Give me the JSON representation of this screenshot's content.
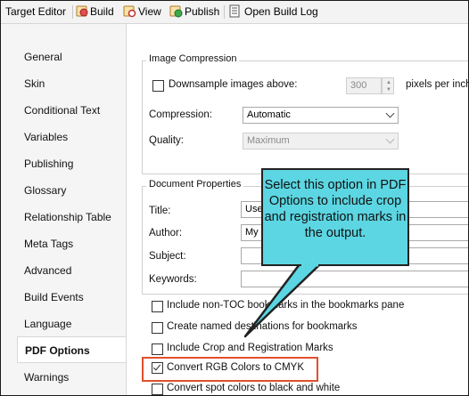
{
  "toolbar": {
    "title": "Target Editor",
    "build": "Build",
    "view": "View",
    "publish": "Publish",
    "open_build_log": "Open Build Log"
  },
  "nav": {
    "items": [
      "General",
      "Skin",
      "Conditional Text",
      "Variables",
      "Publishing",
      "Glossary",
      "Relationship Table",
      "Meta Tags",
      "Advanced",
      "Build Events",
      "Language",
      "PDF Options",
      "Warnings"
    ],
    "active": "PDF Options"
  },
  "image_compression": {
    "title": "Image Compression",
    "downsample_label": "Downsample images above:",
    "downsample_value": "300",
    "downsample_unit": "pixels per inch",
    "downsample_checked": false,
    "compression_label": "Compression:",
    "compression_value": "Automatic",
    "quality_label": "Quality:",
    "quality_value": "Maximum"
  },
  "document_properties": {
    "title": "Document Properties",
    "title_label": "Title:",
    "title_value": "User",
    "author_label": "Author:",
    "author_value": "My N",
    "subject_label": "Subject:",
    "subject_value": "",
    "keywords_label": "Keywords:",
    "keywords_value": ""
  },
  "options": [
    {
      "label": "Include non-TOC bookmarks in the bookmarks pane",
      "checked": false
    },
    {
      "label": "Create named destinations for bookmarks",
      "checked": false
    },
    {
      "label": "Include Crop and Registration Marks",
      "checked": false
    },
    {
      "label": "Convert RGB Colors to CMYK",
      "checked": true
    },
    {
      "label": "Convert spot colors to black and white",
      "checked": false
    }
  ],
  "callout": {
    "text": "Select this option in PDF Options to include crop and registration marks in the output."
  },
  "colors": {
    "callout_fill": "#5bd6e2",
    "highlight": "#e0502a"
  }
}
